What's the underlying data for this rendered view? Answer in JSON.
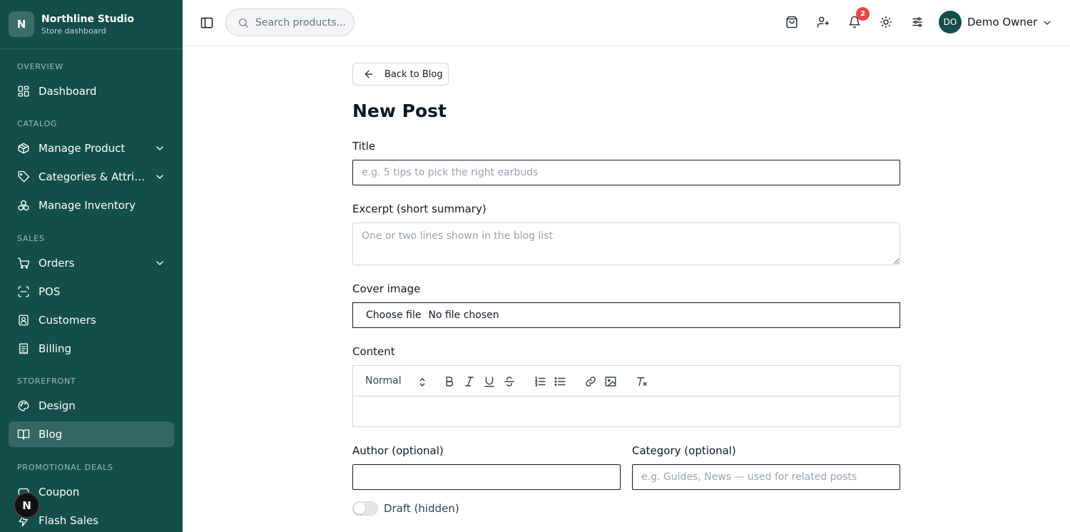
{
  "brand": {
    "logo_letter": "N",
    "name": "Northline Studio",
    "subtitle": "Store dashboard"
  },
  "sidebar": {
    "sections": [
      {
        "label": "OVERVIEW"
      },
      {
        "label": "CATALOG"
      },
      {
        "label": "SALES"
      },
      {
        "label": "STOREFRONT"
      },
      {
        "label": "PROMOTIONAL DEALS"
      }
    ],
    "items": [
      {
        "label": "Dashboard",
        "icon": "dashboard-icon"
      },
      {
        "label": "Manage Product",
        "icon": "box-icon",
        "expandable": true
      },
      {
        "label": "Categories & Attributes",
        "icon": "tag-icon",
        "expandable": true
      },
      {
        "label": "Manage Inventory",
        "icon": "boxes-icon"
      },
      {
        "label": "Orders",
        "icon": "cart-icon",
        "expandable": true
      },
      {
        "label": "POS",
        "icon": "scan-icon"
      },
      {
        "label": "Customers",
        "icon": "contact-icon"
      },
      {
        "label": "Billing",
        "icon": "receipt-icon"
      },
      {
        "label": "Design",
        "icon": "palette-icon"
      },
      {
        "label": "Blog",
        "icon": "book-open-icon",
        "active": true
      },
      {
        "label": "Coupon",
        "icon": "ticket-icon"
      },
      {
        "label": "Flash Sales",
        "icon": "zap-icon"
      }
    ],
    "floating_badge": "N"
  },
  "topbar": {
    "search_placeholder": "Search products...",
    "notification_count": "2",
    "user": {
      "initials": "DO",
      "name": "Demo Owner"
    },
    "icons": [
      "shopping-bag-icon",
      "user-plus-icon",
      "bell-icon",
      "sun-icon",
      "sliders-icon"
    ]
  },
  "main": {
    "back_label": "Back to Blog",
    "title": "New Post",
    "fields": {
      "title_label": "Title",
      "title_placeholder": "e.g. 5 tips to pick the right earbuds",
      "excerpt_label": "Excerpt (short summary)",
      "excerpt_placeholder": "One or two lines shown in the blog list",
      "cover_label": "Cover image",
      "cover_button": "Choose file",
      "cover_status": "No file chosen",
      "content_label": "Content",
      "content_format": "Normal",
      "author_label": "Author (optional)",
      "author_value": "",
      "category_label": "Category (optional)",
      "category_placeholder": "e.g. Guides, News — used for related posts",
      "draft_label": "Draft (hidden)",
      "draft_on": false
    }
  },
  "colors": {
    "sidebar_bg": "#134e4a",
    "badge": "#ef4444",
    "border": "#d1d5db"
  }
}
